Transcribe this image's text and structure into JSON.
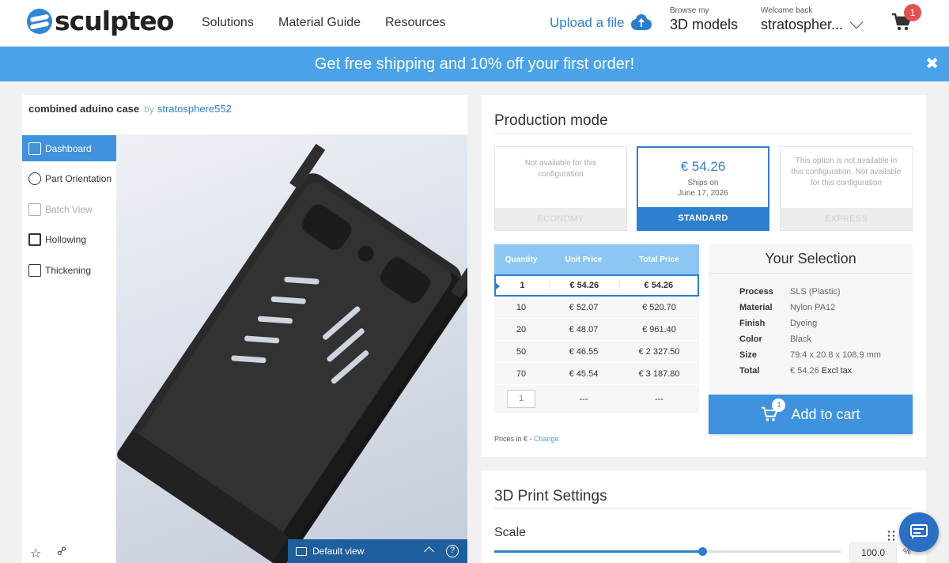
{
  "header": {
    "logo": "sculpteo",
    "nav": [
      "Solutions",
      "Material Guide",
      "Resources"
    ],
    "upload_label": "Upload a file",
    "browse_small": "Browse my",
    "browse_big": "3D models",
    "welcome_small": "Welcome back",
    "welcome_user": "stratospher...",
    "cart_count": "1"
  },
  "banner": {
    "text": "Get free shipping and 10% off your first order!",
    "close": "✖"
  },
  "model": {
    "name": "combined aduino case",
    "by": "by",
    "author": "stratosphere552"
  },
  "tools": [
    {
      "label": "Dashboard",
      "icon": "cube-icon"
    },
    {
      "label": "Part Orientation",
      "icon": "orientation-icon"
    },
    {
      "label": "Batch View",
      "icon": "batch-view-icon"
    },
    {
      "label": "Hollowing",
      "icon": "hollowing-icon"
    },
    {
      "label": "Thickening",
      "icon": "thickening-icon"
    }
  ],
  "viewer": {
    "view_label": "Default view",
    "help": "?"
  },
  "production": {
    "title": "Production mode",
    "modes": [
      {
        "message": "Not available for this configuration",
        "footer": "ECONOMY"
      },
      {
        "price": "€ 54.26",
        "ships_line1": "Ships on",
        "ships_line2": "June 17, 2026",
        "footer": "STANDARD"
      },
      {
        "message": "This option is not available in this configuration. Not available for this configuration",
        "footer": "EXPRESS"
      }
    ],
    "table": {
      "headers": [
        "Quantity",
        "Unit Price",
        "Total Price"
      ],
      "rows": [
        [
          "1",
          "€ 54.26",
          "€ 54.26"
        ],
        [
          "10",
          "€ 52.07",
          "€ 520.70"
        ],
        [
          "20",
          "€ 48.07",
          "€ 961.40"
        ],
        [
          "50",
          "€ 46.55",
          "€ 2 327.50"
        ],
        [
          "70",
          "€ 45.54",
          "€ 3 187.80"
        ]
      ],
      "custom_qty": "1",
      "custom_unit": "---",
      "custom_total": "---"
    },
    "prices_note": "Prices in € - ",
    "change_label": "Change"
  },
  "selection": {
    "title": "Your Selection",
    "specs": [
      {
        "key": "Process",
        "value": "SLS (Plastic)"
      },
      {
        "key": "Material",
        "value": "Nylon PA12"
      },
      {
        "key": "Finish",
        "value": "Dyeing"
      },
      {
        "key": "Color",
        "value": "Black"
      },
      {
        "key": "Size",
        "value": "79.4 x 20.8 x 108.9 mm"
      },
      {
        "key": "Total",
        "value": "€ 54.26"
      }
    ],
    "excl_tax": "Excl tax",
    "add_to_cart": "Add to cart",
    "cart_badge": "1"
  },
  "settings": {
    "title": "3D Print Settings",
    "scale_label": "Scale",
    "scale_value": "100.0",
    "scale_unit": "%",
    "scale_slider_fraction": 0.6
  },
  "colors": {
    "brand_blue": "#2a7fd2",
    "banner_blue": "#4aa3e8",
    "active_blue": "#3f93de",
    "badge_red": "#e35252"
  }
}
